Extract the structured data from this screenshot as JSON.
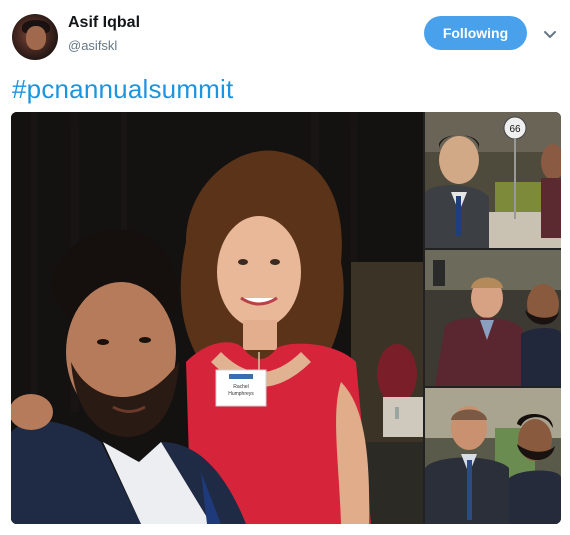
{
  "user": {
    "name": "Asif Iqbal",
    "handle": "@asifskl"
  },
  "follow_button": {
    "label": "Following"
  },
  "menu": {
    "icon": "chevron-down-icon"
  },
  "tweet": {
    "hashtag": "#pcnannualsummit"
  },
  "photos": {
    "badge": {
      "line1": "Rachel",
      "line2": "Humphreys"
    },
    "table_sign": "66"
  },
  "colors": {
    "accent": "#1b95e0",
    "button": "#4aa1eb",
    "name": "#14171a",
    "handle": "#657786"
  }
}
